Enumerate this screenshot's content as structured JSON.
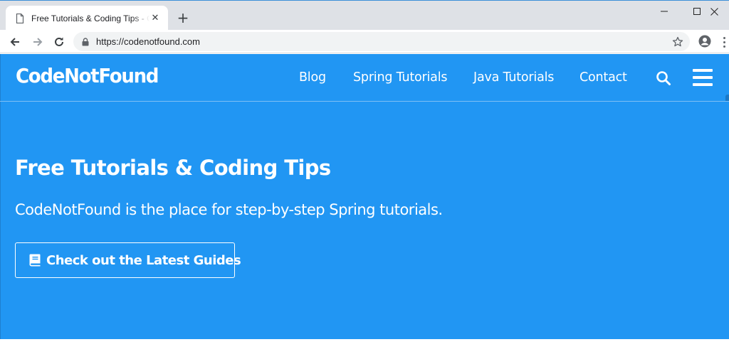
{
  "browser": {
    "tab_title": "Free Tutorials & Coding Tips - CodeNotFound",
    "url": "https://codenotfound.com"
  },
  "site": {
    "brand": "CodeNotFound",
    "nav": [
      "Blog",
      "Spring Tutorials",
      "Java Tutorials",
      "Contact"
    ],
    "brand_color": "#2196f3"
  },
  "hero": {
    "title": "Free Tutorials & Coding Tips",
    "subtitle": "CodeNotFound is the place for step-by-step Spring tutorials.",
    "button_label": "Check out the Latest Guides",
    "button_icon": "book-icon"
  }
}
